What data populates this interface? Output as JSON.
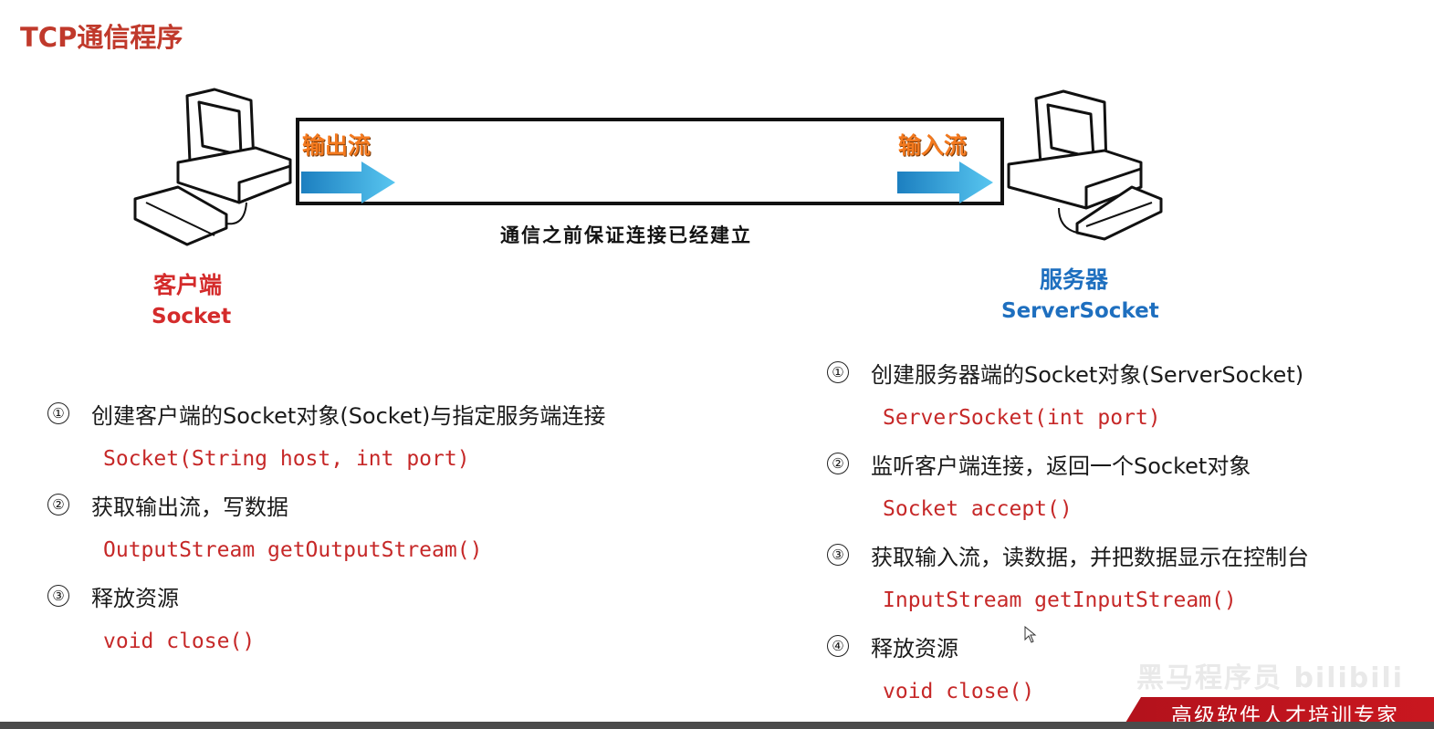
{
  "title": "TCP通信程序",
  "pipe": {
    "output_label": "输出流",
    "input_label": "输入流",
    "caption": "通信之前保证连接已经建立"
  },
  "client": {
    "title": "客户端",
    "subtitle": "Socket",
    "icon": "computer-icon",
    "steps": [
      {
        "num": "①",
        "text": "创建客户端的Socket对象(Socket)与指定服务端连接",
        "code": "Socket(String host, int port)"
      },
      {
        "num": "②",
        "text": "获取输出流，写数据",
        "code": "OutputStream getOutputStream()"
      },
      {
        "num": "③",
        "text": "释放资源",
        "code": "void close()"
      }
    ]
  },
  "server": {
    "title": "服务器",
    "subtitle": "ServerSocket",
    "icon": "computer-icon",
    "steps": [
      {
        "num": "①",
        "text": "创建服务器端的Socket对象(ServerSocket)",
        "code": "ServerSocket(int port)"
      },
      {
        "num": "②",
        "text": "监听客户端连接，返回一个Socket对象",
        "code": "Socket accept()"
      },
      {
        "num": "③",
        "text": "获取输入流，读数据，并把数据显示在控制台",
        "code": "InputStream getInputStream()"
      },
      {
        "num": "④",
        "text": "释放资源",
        "code": "void close()"
      }
    ]
  },
  "footer": {
    "brand": "高级软件人才培训专家",
    "watermark": "黑马程序员 bilibili"
  },
  "colors": {
    "title": "#c0392b",
    "client": "#d42b2b",
    "server": "#1e6fbf",
    "code": "#c62828",
    "stream_label": "#f47a1f",
    "arrow": "#2ea7dc",
    "brand_bar": "#b3121c"
  }
}
